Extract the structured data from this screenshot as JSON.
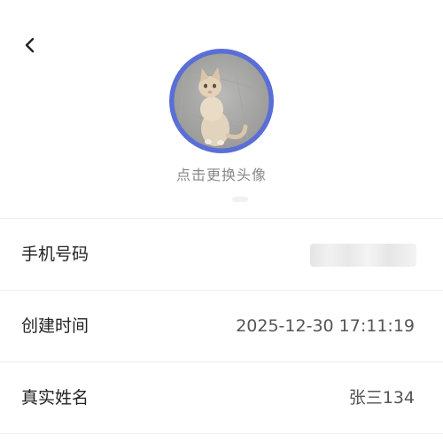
{
  "avatar": {
    "hint_label": "点击更换头像",
    "ring_color": "#5a6fd6"
  },
  "profile": {
    "rows": [
      {
        "label": "手机号码",
        "value": ""
      },
      {
        "label": "创建时间",
        "value": "2025-12-30 17:11:19"
      },
      {
        "label": "真实姓名",
        "value": "张三134"
      }
    ]
  },
  "icons": {
    "back": "chevron-left-icon"
  }
}
